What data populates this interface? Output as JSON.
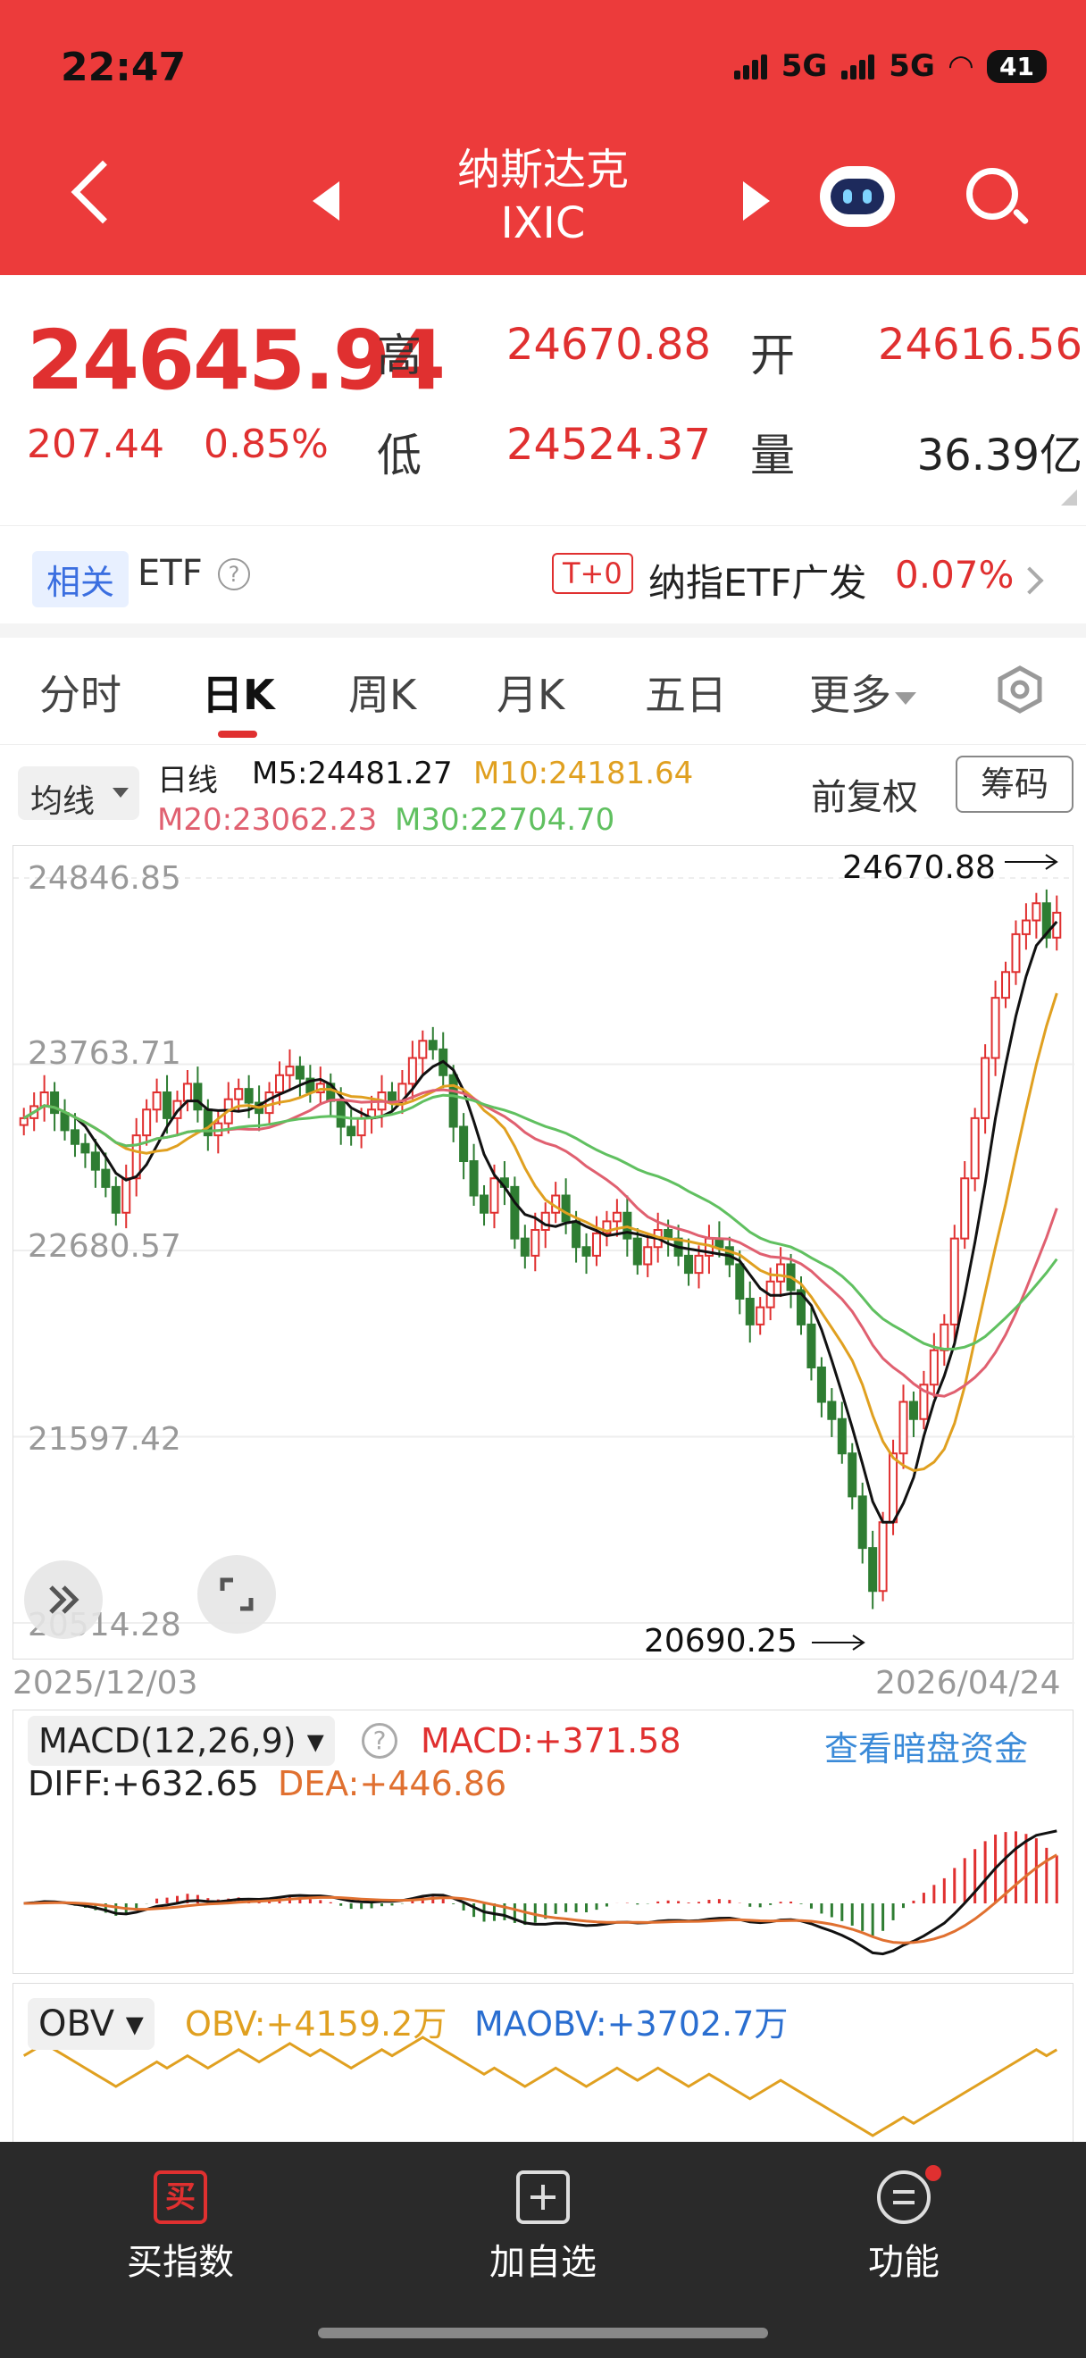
{
  "status_bar": {
    "time": "22:47",
    "network1": "5G",
    "network2": "5G",
    "battery": "41"
  },
  "header": {
    "name": "纳斯达克",
    "code": "IXIC"
  },
  "quote": {
    "price": "24645.94",
    "change": "207.44",
    "change_pct": "0.85%",
    "high_label": "高",
    "high": "24670.88",
    "open_label": "开",
    "open": "24616.56",
    "low_label": "低",
    "low": "24524.37",
    "volume_label": "量",
    "volume": "36.39亿"
  },
  "etf": {
    "tag": "相关",
    "label": "ETF",
    "t0": "T+0",
    "name": "纳指ETF广发",
    "pct": "0.07%"
  },
  "tabs": [
    "分时",
    "日K",
    "周K",
    "月K",
    "五日",
    "更多"
  ],
  "active_tab": "日K",
  "ma_legend": {
    "button": "均线",
    "period": "日线",
    "m5": "M5:24481.27",
    "m10": "M10:24181.64",
    "m20": "M20:23062.23",
    "m30": "M30:22704.70",
    "adjust": "前复权",
    "chips": "筹码"
  },
  "colors": {
    "up": "#e03030",
    "down": "#2e7d32",
    "m5": "#111111",
    "m10": "#e0a020",
    "m20": "#e06070",
    "m30": "#60c060",
    "brand": "#ec3b3b"
  },
  "chart_data": {
    "type": "candlestick",
    "y_ticks": [
      "24846.85",
      "23763.71",
      "22680.57",
      "21597.42",
      "20514.28"
    ],
    "ylim": [
      20514.28,
      24846.85
    ],
    "x_start": "2025/12/03",
    "x_end": "2026/04/24",
    "max_annotation": "24670.88",
    "min_annotation": "20690.25",
    "close_approx": [
      23450,
      23520,
      23600,
      23480,
      23380,
      23300,
      23250,
      23150,
      23050,
      22900,
      23100,
      23350,
      23500,
      23600,
      23450,
      23550,
      23650,
      23500,
      23350,
      23420,
      23560,
      23620,
      23540,
      23480,
      23600,
      23700,
      23750,
      23680,
      23600,
      23650,
      23550,
      23400,
      23350,
      23450,
      23500,
      23600,
      23550,
      23650,
      23800,
      23900,
      23850,
      23700,
      23400,
      23200,
      23000,
      22900,
      23100,
      23050,
      22750,
      22650,
      22800,
      22900,
      23000,
      22850,
      22700,
      22650,
      22780,
      22850,
      22900,
      22750,
      22600,
      22700,
      22800,
      22750,
      22650,
      22550,
      22650,
      22750,
      22700,
      22600,
      22400,
      22250,
      22350,
      22500,
      22600,
      22450,
      22250,
      22000,
      21800,
      21700,
      21500,
      21250,
      20950,
      20700,
      21100,
      21500,
      21800,
      21700,
      21900,
      22100,
      22250,
      22750,
      23100,
      23450,
      23800,
      24150,
      24300,
      24520,
      24600,
      24700,
      24500,
      24645
    ]
  },
  "macd": {
    "button": "MACD(12,26,9)",
    "value": "MACD:+371.58",
    "diff": "DIFF:+632.65",
    "dea": "DEA:+446.86",
    "link": "查看暗盘资金"
  },
  "obv": {
    "button": "OBV",
    "obv": "OBV:+4159.2万",
    "maobv": "MAOBV:+3702.7万"
  },
  "bottom_nav": {
    "buy": "买指数",
    "buy_icon": "买",
    "add": "加自选",
    "func": "功能"
  }
}
